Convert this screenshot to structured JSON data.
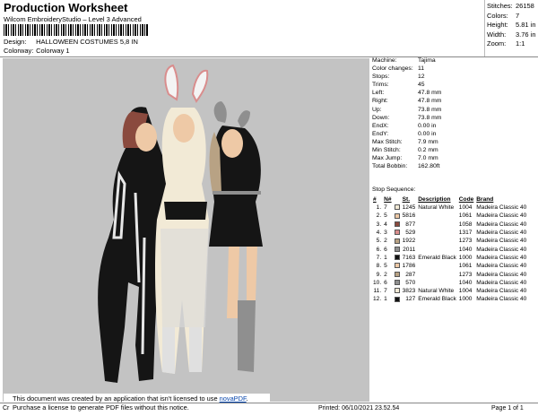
{
  "header": {
    "title": "Production Worksheet",
    "subtitle": "Wilcom EmbroideryStudio – Level 3 Advanced",
    "design_label": "Design:",
    "design_value": "HALLOWEEN COSTUMES 5,8 IN",
    "colorway_label": "Colorway:",
    "colorway_value": "Colorway 1"
  },
  "stats": [
    {
      "label": "Stitches:",
      "value": "26158"
    },
    {
      "label": "Colors:",
      "value": "7"
    },
    {
      "label": "Height:",
      "value": "5.81 in"
    },
    {
      "label": "Width:",
      "value": "3.76 in"
    },
    {
      "label": "Zoom:",
      "value": "1:1"
    }
  ],
  "machine_info": [
    {
      "label": "Machine:",
      "value": "Tajima"
    },
    {
      "label": "Color changes:",
      "value": "11"
    },
    {
      "label": "Stops:",
      "value": "12"
    },
    {
      "label": "Trims:",
      "value": "45"
    },
    {
      "label": "Left:",
      "value": "47.8 mm"
    },
    {
      "label": "Right:",
      "value": "47.8 mm"
    },
    {
      "label": "Up:",
      "value": "73.8 mm"
    },
    {
      "label": "Down:",
      "value": "73.8 mm"
    },
    {
      "label": "EndX:",
      "value": "0.00 in"
    },
    {
      "label": "EndY:",
      "value": "0.00 in"
    },
    {
      "label": "Max Stitch:",
      "value": "7.9 mm"
    },
    {
      "label": "Min Stitch:",
      "value": "0.2 mm"
    },
    {
      "label": "Max Jump:",
      "value": "7.0 mm"
    },
    {
      "label": "Total Bobbin:",
      "value": "162.80ft"
    }
  ],
  "stop_sequence": {
    "title": "Stop Sequence:",
    "columns": [
      "#",
      "N#",
      "",
      "St.",
      "Description",
      "Code",
      "Brand"
    ],
    "rows": [
      {
        "n": "1.",
        "needle": "7",
        "color": "#f2ead6",
        "st": "1245",
        "desc": "Natural White",
        "code": "1004",
        "brand": "Madeira Classic 40"
      },
      {
        "n": "2.",
        "needle": "5",
        "color": "#eec9a6",
        "st": "5816",
        "desc": "",
        "code": "1061",
        "brand": "Madeira Classic 40"
      },
      {
        "n": "3.",
        "needle": "4",
        "color": "#8a4a3e",
        "st": "877",
        "desc": "",
        "code": "1058",
        "brand": "Madeira Classic 40"
      },
      {
        "n": "4.",
        "needle": "3",
        "color": "#d98d8d",
        "st": "529",
        "desc": "",
        "code": "1317",
        "brand": "Madeira Classic 40"
      },
      {
        "n": "5.",
        "needle": "2",
        "color": "#b8a284",
        "st": "1922",
        "desc": "",
        "code": "1273",
        "brand": "Madeira Classic 40"
      },
      {
        "n": "6.",
        "needle": "6",
        "color": "#8f8f8f",
        "st": "2011",
        "desc": "",
        "code": "1040",
        "brand": "Madeira Classic 40"
      },
      {
        "n": "7.",
        "needle": "1",
        "color": "#111111",
        "st": "7163",
        "desc": "Emerald Black",
        "code": "1000",
        "brand": "Madeira Classic 40"
      },
      {
        "n": "8.",
        "needle": "5",
        "color": "#eec9a6",
        "st": "1786",
        "desc": "",
        "code": "1061",
        "brand": "Madeira Classic 40"
      },
      {
        "n": "9.",
        "needle": "2",
        "color": "#b8a284",
        "st": "287",
        "desc": "",
        "code": "1273",
        "brand": "Madeira Classic 40"
      },
      {
        "n": "10.",
        "needle": "6",
        "color": "#8f8f8f",
        "st": "570",
        "desc": "",
        "code": "1040",
        "brand": "Madeira Classic 40"
      },
      {
        "n": "11.",
        "needle": "7",
        "color": "#f2ead6",
        "st": "3823",
        "desc": "Natural White",
        "code": "1004",
        "brand": "Madeira Classic 40"
      },
      {
        "n": "12.",
        "needle": "1",
        "color": "#111111",
        "st": "127",
        "desc": "Emerald Black",
        "code": "1000",
        "brand": "Madeira Classic 40"
      }
    ]
  },
  "notice": {
    "line1_before": "This document was created by an application that isn't licensed to use ",
    "link": "novaPDF",
    "line1_after": ".",
    "line2": "Purchase a license to generate PDF files without this notice."
  },
  "footer": {
    "left": "Cr",
    "printed": "Printed: 06/10/2021 23.52.54",
    "page": "Page 1 of 1"
  }
}
